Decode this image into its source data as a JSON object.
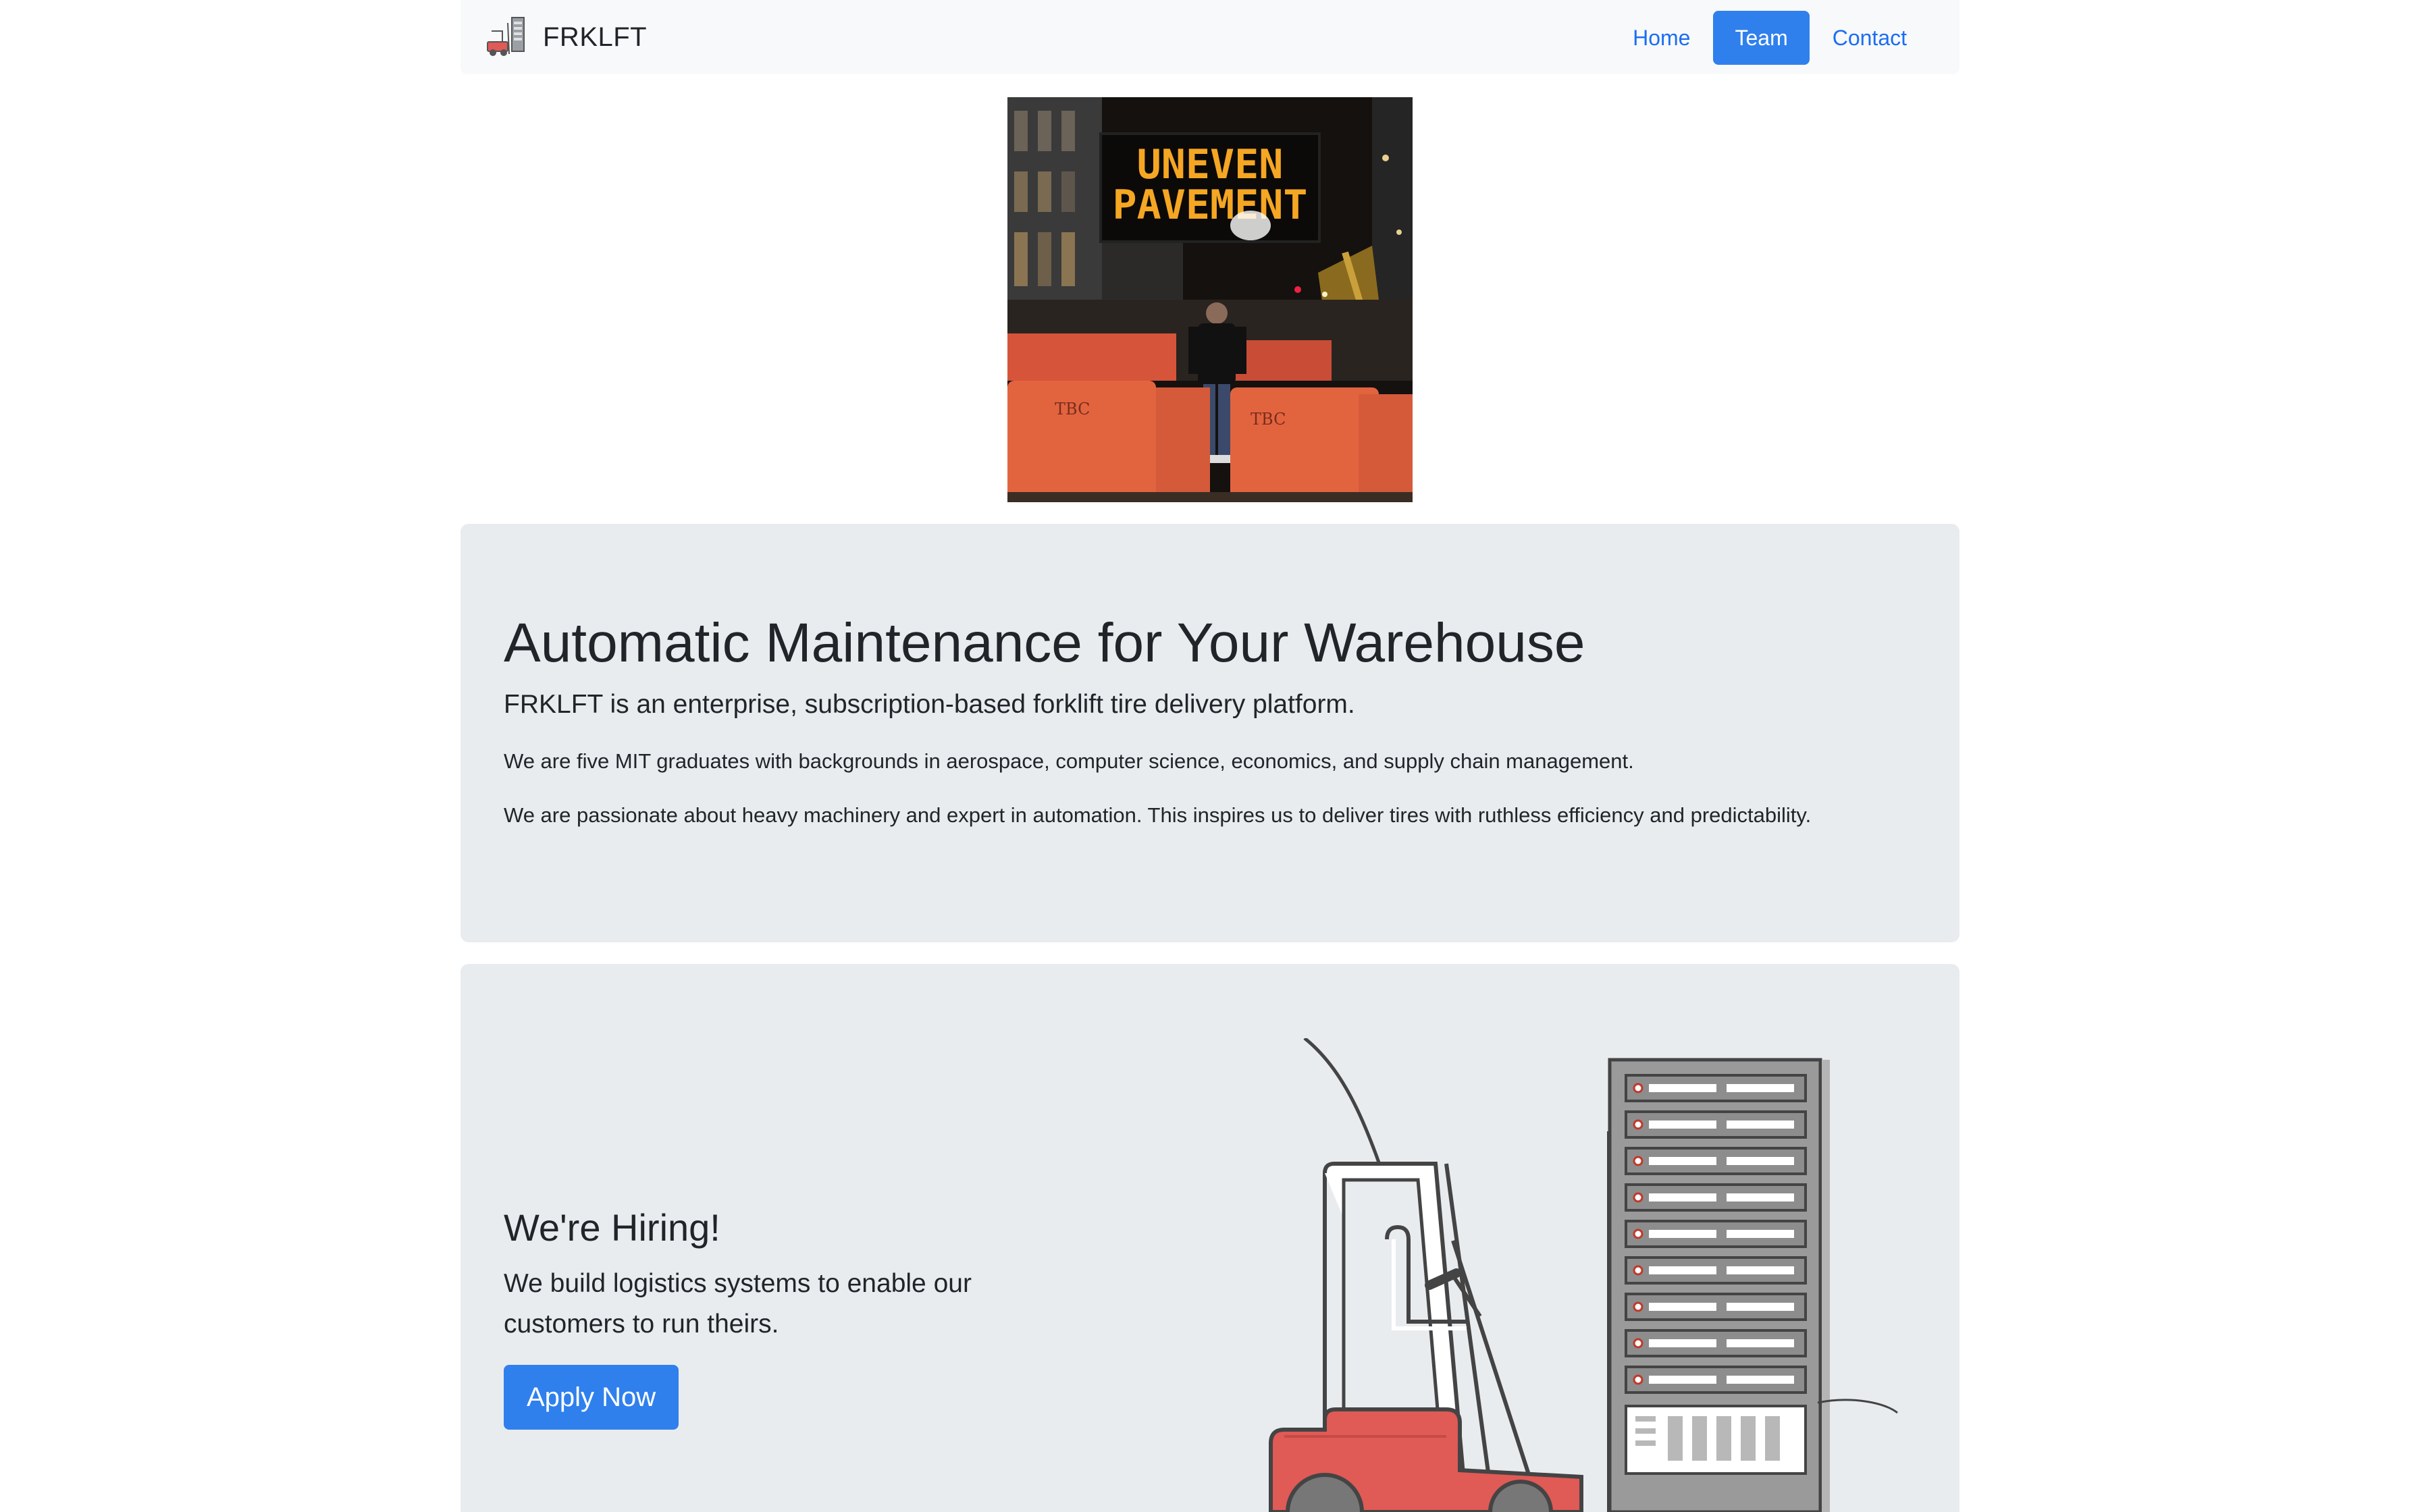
{
  "navbar": {
    "brand": "FRKLFT",
    "links": [
      {
        "label": "Home",
        "active": false
      },
      {
        "label": "Team",
        "active": true
      },
      {
        "label": "Contact",
        "active": false
      }
    ]
  },
  "photo": {
    "sign_line1": "UNEVEN",
    "sign_line2": "PAVEMENT",
    "barrier_text": "TBC"
  },
  "hero": {
    "title": "Automatic Maintenance for Your Warehouse",
    "lead": "FRKLFT is an enterprise, subscription-based forklift tire delivery platform.",
    "paragraph1": "We are five MIT graduates with backgrounds in aerospace, computer science, economics, and supply chain management.",
    "paragraph2": "We are passionate about heavy machinery and expert in automation. This inspires us to deliver tires with ruthless efficiency and predictability."
  },
  "hiring": {
    "title": "We're Hiring!",
    "lead": "We build logistics systems to enable our customers to run theirs.",
    "button_label": "Apply Now"
  },
  "colors": {
    "accent": "#2f80ed",
    "link": "#1b6ef3",
    "jumbotron_bg": "#e9ecef",
    "navbar_bg": "#f8f9fa",
    "forklift_red": "#e05a56"
  }
}
